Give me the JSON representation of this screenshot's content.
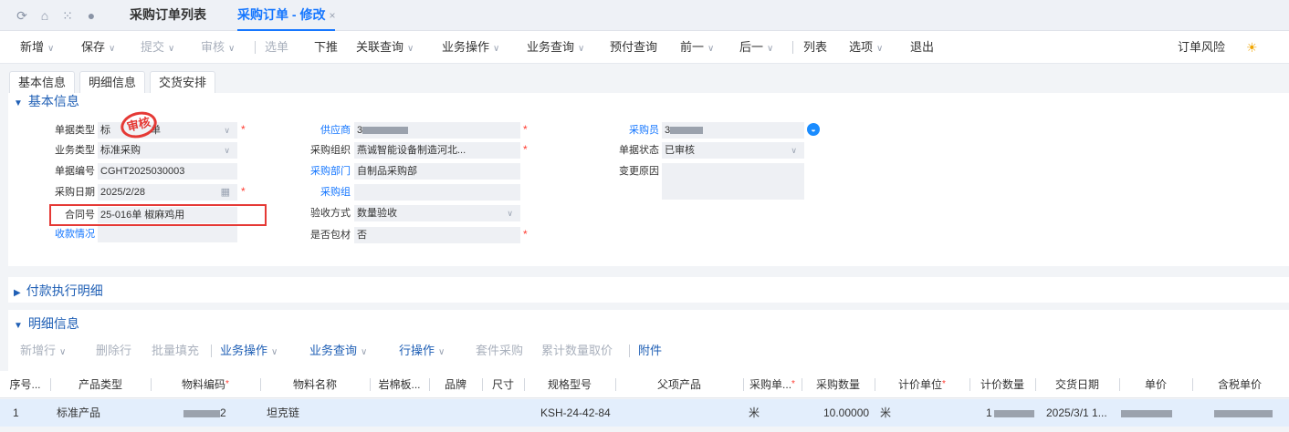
{
  "top_tabs": [
    {
      "label": "采购订单列表"
    },
    {
      "label": "采购订单 - 修改",
      "close": "×"
    }
  ],
  "toolbar": [
    {
      "label": "新增",
      "dropdown": true,
      "disabled": false
    },
    {
      "label": "保存",
      "dropdown": true,
      "disabled": false
    },
    {
      "label": "提交",
      "dropdown": true,
      "disabled": true
    },
    {
      "label": "审核",
      "dropdown": true,
      "disabled": true
    },
    {
      "label": "选单",
      "dropdown": false,
      "disabled": true
    },
    {
      "label": "下推",
      "dropdown": false,
      "disabled": false
    },
    {
      "label": "关联查询",
      "dropdown": true,
      "disabled": false
    },
    {
      "label": "业务操作",
      "dropdown": true,
      "disabled": false
    },
    {
      "label": "业务查询",
      "dropdown": true,
      "disabled": false
    },
    {
      "label": "预付查询",
      "dropdown": false,
      "disabled": false
    },
    {
      "label": "前一",
      "dropdown": true,
      "disabled": false
    },
    {
      "label": "后一",
      "dropdown": true,
      "disabled": false
    },
    {
      "label": "列表",
      "dropdown": false,
      "disabled": false
    },
    {
      "label": "选项",
      "dropdown": true,
      "disabled": false
    },
    {
      "label": "退出",
      "dropdown": false,
      "disabled": false
    }
  ],
  "toolbar_right": {
    "order_risk": "订单风险"
  },
  "sub_tabs": [
    "基本信息",
    "明细信息",
    "交货安排"
  ],
  "basic_info": {
    "title": "基本信息",
    "stamp": "审核",
    "bill_type": {
      "label": "单据类型",
      "value_prefix": "标",
      "value_suffix": "单"
    },
    "biz_type": {
      "label": "业务类型",
      "value": "标准采购"
    },
    "bill_no": {
      "label": "单据编号",
      "value": "CGHT2025030003"
    },
    "purchase_date": {
      "label": "采购日期",
      "value": "2025/2/28"
    },
    "contract_no": {
      "label": "合同号",
      "value": "25-016单 椒麻鸡用"
    },
    "payment_status": {
      "label": "收款情况",
      "value": ""
    },
    "supplier": {
      "label": "供应商",
      "value": "3"
    },
    "purchase_org": {
      "label": "采购组织",
      "value": "燕诚智能设备制造河北..."
    },
    "purchase_dept": {
      "label": "采购部门",
      "value": "自制品采购部"
    },
    "purchase_group": {
      "label": "采购组",
      "value": ""
    },
    "inspection_method": {
      "label": "验收方式",
      "value": "数量验收"
    },
    "is_packaging": {
      "label": "是否包材",
      "value": "否"
    },
    "purchaser": {
      "label": "采购员",
      "value": "3"
    },
    "bill_status": {
      "label": "单据状态",
      "value": "已审核"
    },
    "change_reason": {
      "label": "变更原因",
      "value": ""
    }
  },
  "payment_section": {
    "title": "付款执行明细"
  },
  "detail_section": {
    "title": "明细信息",
    "toolbar": [
      {
        "label": "新增行",
        "dropdown": true,
        "style": "dis"
      },
      {
        "label": "删除行",
        "dropdown": false,
        "style": "dis"
      },
      {
        "label": "批量填充",
        "dropdown": false,
        "style": "dis"
      },
      {
        "label": "业务操作",
        "dropdown": true,
        "style": "act"
      },
      {
        "label": "业务查询",
        "dropdown": true,
        "style": "act"
      },
      {
        "label": "行操作",
        "dropdown": true,
        "style": "act"
      },
      {
        "label": "套件采购",
        "dropdown": false,
        "style": "dis"
      },
      {
        "label": "累计数量取价",
        "dropdown": false,
        "style": "dis"
      },
      {
        "label": "附件",
        "dropdown": false,
        "style": "act"
      }
    ],
    "columns": [
      {
        "label": "序号..."
      },
      {
        "label": "产品类型"
      },
      {
        "label": "物料编码",
        "required": true
      },
      {
        "label": "物料名称"
      },
      {
        "label": "岩棉板..."
      },
      {
        "label": "品牌"
      },
      {
        "label": "尺寸"
      },
      {
        "label": "规格型号"
      },
      {
        "label": "父项产品"
      },
      {
        "label": "采购单...",
        "required": true
      },
      {
        "label": "采购数量"
      },
      {
        "label": "计价单位",
        "required": true
      },
      {
        "label": "计价数量"
      },
      {
        "label": "交货日期"
      },
      {
        "label": "单价"
      },
      {
        "label": "含税单价"
      }
    ],
    "rows": [
      {
        "seq": "1",
        "product_type": "标准产品",
        "material_code_suffix": "2",
        "material_name": "坦克链",
        "spec": "KSH-24-42-84",
        "purchase_unit": "米",
        "purchase_qty": "10.00000",
        "pricing_unit": "米",
        "pricing_qty_prefix": "1",
        "delivery_date": "2025/3/1 1..."
      }
    ]
  },
  "colors": {
    "accent": "#1677ff",
    "section_title": "#1f5fb5",
    "required": "#ff3b30",
    "stamp": "#e53935",
    "highlight_box": "#e53935",
    "selected_row": "#e3eefc"
  }
}
